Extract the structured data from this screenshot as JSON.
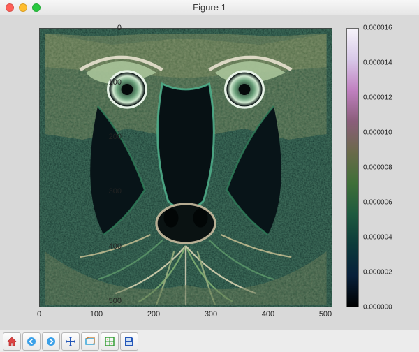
{
  "window": {
    "title": "Figure 1"
  },
  "chart_data": {
    "type": "image",
    "description": "2D scalar field (gradient-magnitude style) of the classic 512×512 mandrill/baboon test image, rendered with a dark-to-light multihue colormap.",
    "extent": {
      "x": [
        0,
        512
      ],
      "y": [
        0,
        512
      ]
    },
    "origin": "upper",
    "colormap": "gist_earth-like (black → dark teal → green → olive → magenta → near-white)",
    "value_range": [
      0.0,
      1.6e-05
    ],
    "x_ticks": [
      0,
      100,
      200,
      300,
      400,
      500
    ],
    "y_ticks": [
      0,
      100,
      200,
      300,
      400,
      500
    ],
    "colorbar_ticks": [
      0.0,
      2e-06,
      4e-06,
      6e-06,
      8e-06,
      1e-05,
      1.2e-05,
      1.4e-05,
      1.6e-05
    ],
    "xlabel": "",
    "ylabel": "",
    "title": ""
  },
  "x_ticks": {
    "0": "0",
    "1": "100",
    "2": "200",
    "3": "300",
    "4": "400",
    "5": "500"
  },
  "y_ticks": {
    "0": "0",
    "1": "100",
    "2": "200",
    "3": "300",
    "4": "400",
    "5": "500"
  },
  "c_ticks": {
    "0": "0.000000",
    "1": "0.000002",
    "2": "0.000004",
    "3": "0.000006",
    "4": "0.000008",
    "5": "0.000010",
    "6": "0.000012",
    "7": "0.000014",
    "8": "0.000016"
  },
  "toolbar": {
    "home": "home-icon",
    "back": "back-icon",
    "forward": "forward-icon",
    "pan": "pan-icon",
    "zoom": "zoom-icon",
    "subplots": "subplots-icon",
    "save": "save-icon"
  }
}
